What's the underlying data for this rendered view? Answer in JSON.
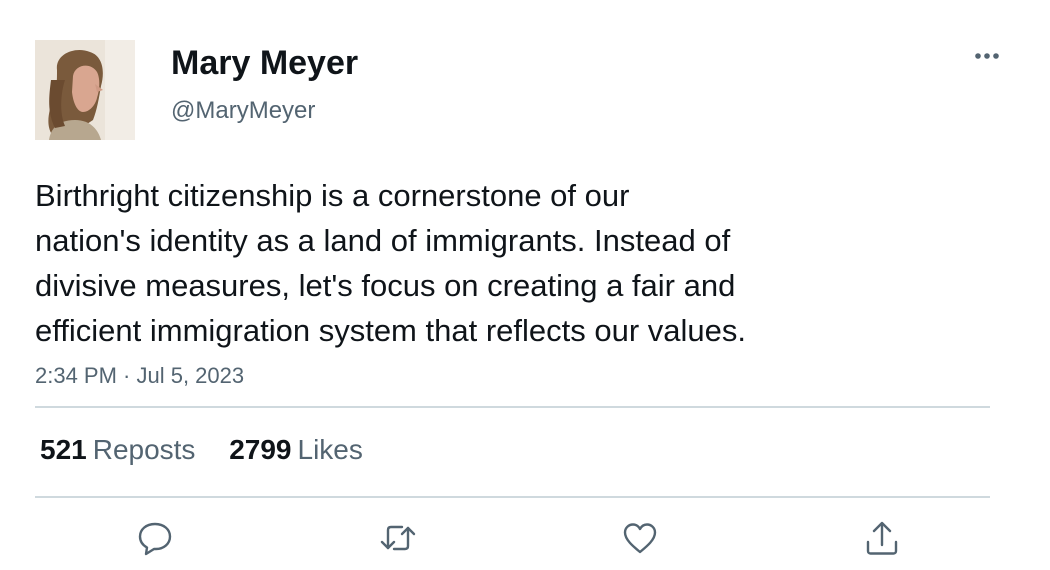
{
  "author": {
    "display_name": "Mary Meyer",
    "handle": "@MaryMeyer",
    "avatar_icon": "profile-photo"
  },
  "tweet": {
    "text_lines": [
      "Birthright citizenship is a cornerstone of our",
      "nation's identity as a land of immigrants. Instead of",
      "divisive measures, let's focus on creating a fair and",
      "efficient immigration system that reflects our values."
    ],
    "timestamp": "2:34 PM · Jul 5, 2023"
  },
  "stats": {
    "reposts_count": "521",
    "reposts_label": "Reposts",
    "likes_count": "2799",
    "likes_label": "Likes"
  },
  "actions": [
    {
      "name": "reply",
      "icon": "speech-bubble-icon"
    },
    {
      "name": "repost",
      "icon": "retweet-icon"
    },
    {
      "name": "like",
      "icon": "heart-icon"
    },
    {
      "name": "share",
      "icon": "share-upload-icon"
    }
  ],
  "colors": {
    "text_primary": "#0f1419",
    "text_secondary": "#536471",
    "divider": "#cfd9de",
    "icon": "#536471"
  }
}
